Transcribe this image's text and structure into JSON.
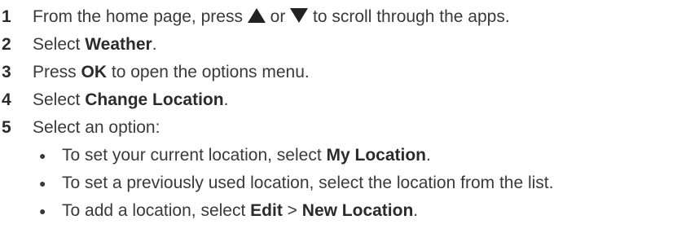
{
  "steps": [
    {
      "number": "1",
      "parts": {
        "a": "From the home page, press",
        "up_icon": "up-triangle-icon",
        "b": "or",
        "down_icon": "down-triangle-icon",
        "c": "to scroll through the apps."
      }
    },
    {
      "number": "2",
      "parts": {
        "a": "Select",
        "bold": "Weather",
        "b": "."
      }
    },
    {
      "number": "3",
      "parts": {
        "a": "Press",
        "bold": "OK",
        "b": "to open the options menu."
      }
    },
    {
      "number": "4",
      "parts": {
        "a": "Select",
        "bold": "Change Location",
        "b": "."
      }
    },
    {
      "number": "5",
      "parts": {
        "a": "Select an option:"
      }
    }
  ],
  "bullets": [
    {
      "a": "To set your current location, select",
      "bold": "My Location",
      "b": "."
    },
    {
      "a": "To set a previously used location, select the location from the list."
    },
    {
      "a": "To add a location, select",
      "bold1": "Edit",
      "sep": ">",
      "bold2": "New Location",
      "b": "."
    }
  ]
}
